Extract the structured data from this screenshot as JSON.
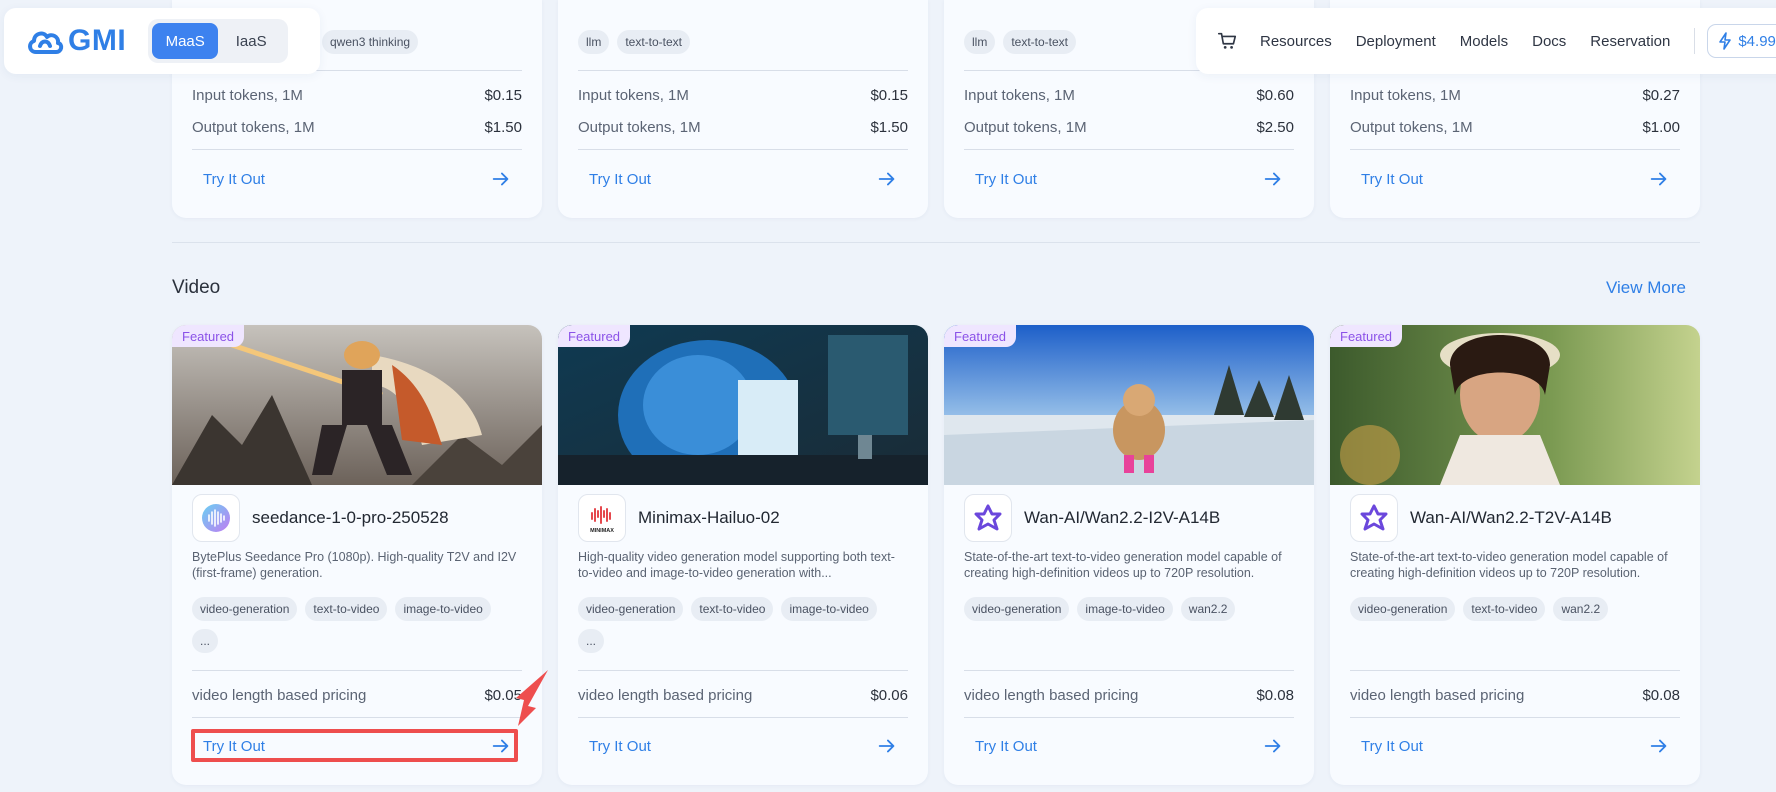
{
  "brand": {
    "logo_text": "GMI",
    "accent": "#2f7fe6"
  },
  "mode_switch": {
    "options": [
      "MaaS",
      "IaaS"
    ],
    "active": "MaaS"
  },
  "nav": {
    "cart_icon": "cart-icon",
    "links": [
      "Resources",
      "Deployment",
      "Models",
      "Docs",
      "Reservation"
    ],
    "credit": "$4.99"
  },
  "llm_cards": [
    {
      "tags": [
        "qwen3 thinking"
      ],
      "input_label": "Input tokens, 1M",
      "input_price": "$0.15",
      "output_label": "Output tokens, 1M",
      "output_price": "$1.50",
      "try": "Try It Out"
    },
    {
      "tags": [
        "llm",
        "text-to-text"
      ],
      "input_label": "Input tokens, 1M",
      "input_price": "$0.15",
      "output_label": "Output tokens, 1M",
      "output_price": "$1.50",
      "try": "Try It Out"
    },
    {
      "tags": [
        "llm",
        "text-to-text"
      ],
      "input_label": "Input tokens, 1M",
      "input_price": "$0.60",
      "output_label": "Output tokens, 1M",
      "output_price": "$2.50",
      "try": "Try It Out"
    },
    {
      "tags": [],
      "input_label": "Input tokens, 1M",
      "input_price": "$0.27",
      "output_label": "Output tokens, 1M",
      "output_price": "$1.00",
      "try": "Try It Out"
    }
  ],
  "video_section": {
    "title": "Video",
    "view_more": "View More"
  },
  "video_cards": [
    {
      "badge": "Featured",
      "name": "seedance-1-0-pro-250528",
      "logo": "bytedance-wave-icon",
      "desc": "BytePlus Seedance Pro (1080p). High-quality T2V and I2V (first-frame) generation.",
      "tags": [
        "video-generation",
        "text-to-video",
        "image-to-video",
        "..."
      ],
      "pricing_label": "video length based pricing",
      "price": "$0.05",
      "try": "Try It Out"
    },
    {
      "badge": "Featured",
      "name": "Minimax-Hailuo-02",
      "logo": "minimax-icon",
      "logo_text": "MINIMAX",
      "desc": "High-quality video generation model supporting both text-to-video and image-to-video generation with...",
      "tags": [
        "video-generation",
        "text-to-video",
        "image-to-video",
        "..."
      ],
      "pricing_label": "video length based pricing",
      "price": "$0.06",
      "try": "Try It Out"
    },
    {
      "badge": "Featured",
      "name": "Wan-AI/Wan2.2-I2V-A14B",
      "logo": "wan-star-icon",
      "desc": "State-of-the-art text-to-video generation model capable of creating high-definition videos up to 720P resolution.",
      "tags": [
        "video-generation",
        "image-to-video",
        "wan2.2"
      ],
      "pricing_label": "video length based pricing",
      "price": "$0.08",
      "try": "Try It Out"
    },
    {
      "badge": "Featured",
      "name": "Wan-AI/Wan2.2-T2V-A14B",
      "logo": "wan-star-icon",
      "desc": "State-of-the-art text-to-video generation model capable of creating high-definition videos up to 720P resolution.",
      "tags": [
        "video-generation",
        "text-to-video",
        "wan2.2"
      ],
      "pricing_label": "video length based pricing",
      "price": "$0.08",
      "try": "Try It Out"
    }
  ]
}
